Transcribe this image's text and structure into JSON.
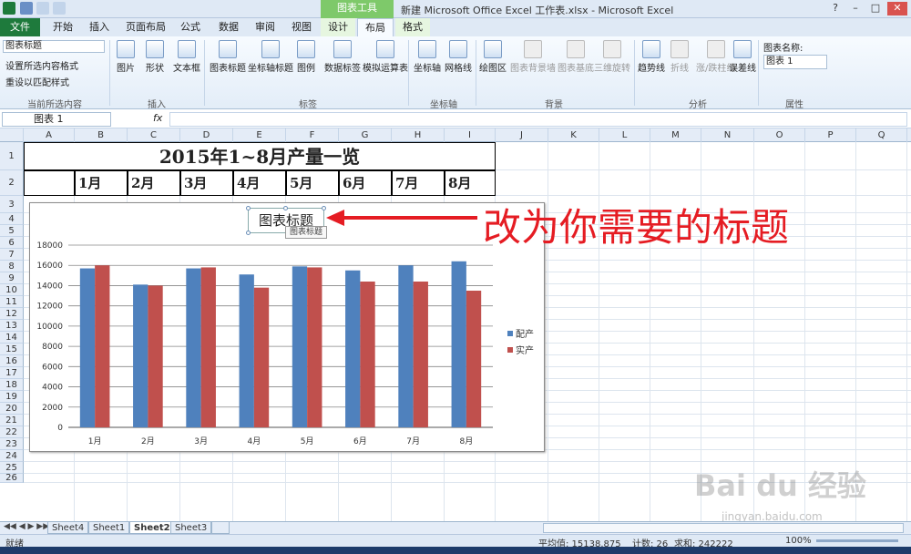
{
  "window": {
    "title": "新建 Microsoft Office Excel 工作表.xlsx - Microsoft Excel",
    "context_band": "图表工具",
    "controls": [
      "?",
      "–",
      "□",
      "✕"
    ]
  },
  "tabs": [
    "文件",
    "开始",
    "插入",
    "页面布局",
    "公式",
    "数据",
    "审阅",
    "视图",
    "设计",
    "布局",
    "格式"
  ],
  "active_tab": "布局",
  "ribbon": {
    "current_selection": {
      "dropdown_value": "图表标题",
      "format_selection": "设置所选内容格式",
      "reset_style": "重设以匹配样式",
      "group_label": "当前所选内容"
    },
    "insert": {
      "buttons": [
        "图片",
        "形状",
        "文本框"
      ],
      "group_label": "插入"
    },
    "labels": {
      "buttons": [
        "图表标题",
        "坐标轴标题",
        "图例",
        "数据标签",
        "模拟运算表"
      ],
      "group_label": "标签"
    },
    "axes": {
      "buttons": [
        "坐标轴",
        "网格线"
      ],
      "group_label": "坐标轴"
    },
    "background": {
      "buttons": [
        "绘图区",
        "图表背景墙",
        "图表基底",
        "三维旋转"
      ],
      "group_label": "背景"
    },
    "analysis": {
      "buttons": [
        "趋势线",
        "折线",
        "涨/跌柱线",
        "误差线"
      ],
      "group_label": "分析"
    },
    "properties": {
      "chart_name_label": "图表名称:",
      "chart_name_value": "图表 1",
      "group_label": "属性"
    }
  },
  "formula_bar": {
    "name_box": "图表 1",
    "fx": "fx",
    "formula": ""
  },
  "columns": [
    "A",
    "B",
    "C",
    "D",
    "E",
    "F",
    "G",
    "H",
    "I",
    "J",
    "K",
    "L",
    "M",
    "N",
    "O",
    "P",
    "Q"
  ],
  "rows": [
    "1",
    "2",
    "3",
    "4",
    "5",
    "6",
    "7",
    "8",
    "9",
    "10",
    "11",
    "12",
    "13",
    "14",
    "15",
    "16",
    "17",
    "18",
    "19",
    "20",
    "21",
    "22",
    "23",
    "24",
    "25",
    "26"
  ],
  "sheet": {
    "table_title": "2015年1~8月产量一览",
    "months": [
      "1月",
      "2月",
      "3月",
      "4月",
      "5月",
      "6月",
      "7月",
      "8月"
    ]
  },
  "chart_title": "图表标题",
  "tooltip": "图表标题",
  "annotation": "改为你需要的标题",
  "chart_data": {
    "type": "bar",
    "title": "图表标题",
    "categories": [
      "1月",
      "2月",
      "3月",
      "4月",
      "5月",
      "6月",
      "7月",
      "8月"
    ],
    "series": [
      {
        "name": "配产",
        "values": [
          15700,
          14100,
          15700,
          15100,
          15900,
          15500,
          16000,
          16400
        ]
      },
      {
        "name": "实产",
        "values": [
          16000,
          14000,
          15800,
          13800,
          15800,
          14400,
          14400,
          13500
        ]
      }
    ],
    "ylim": [
      0,
      18000
    ],
    "yticks": [
      0,
      2000,
      4000,
      6000,
      8000,
      10000,
      12000,
      14000,
      16000,
      18000
    ],
    "grid": true,
    "legend_position": "right",
    "colors": [
      "#4f81bd",
      "#c0504d"
    ]
  },
  "sheets": [
    "Sheet4",
    "Sheet1",
    "Sheet2",
    "Sheet3"
  ],
  "active_sheet": "Sheet2",
  "status": {
    "ready": "就绪",
    "average": "平均值: 15138.875",
    "count": "计数: 26",
    "sum": "求和: 242222",
    "zoom": "100%"
  },
  "watermark": {
    "text": "Bai du 经验",
    "url": "jingyan.baidu.com"
  }
}
